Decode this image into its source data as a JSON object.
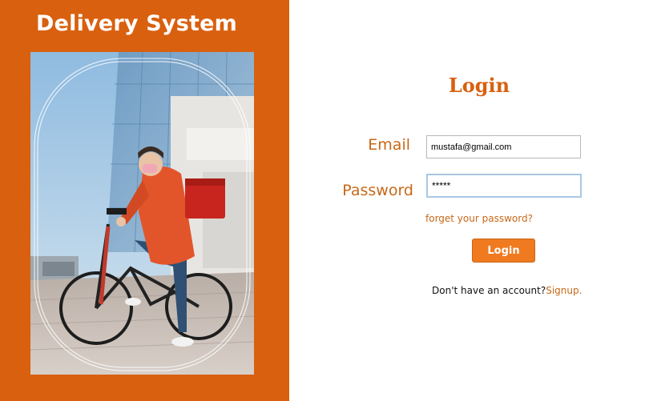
{
  "brand": {
    "title": "Delivery System",
    "accent_color": "#d9600f"
  },
  "hero_image": {
    "description_icon": "delivery-courier-photo"
  },
  "login": {
    "title": "Login",
    "email_label": "Email",
    "email_value": "mustafa@gmail.com",
    "password_label": "Password",
    "password_value": "*****",
    "forgot_text": "forget your password?",
    "button_label": "Login",
    "signup_prompt": "Don't have an account?",
    "signup_link": "Signup."
  }
}
